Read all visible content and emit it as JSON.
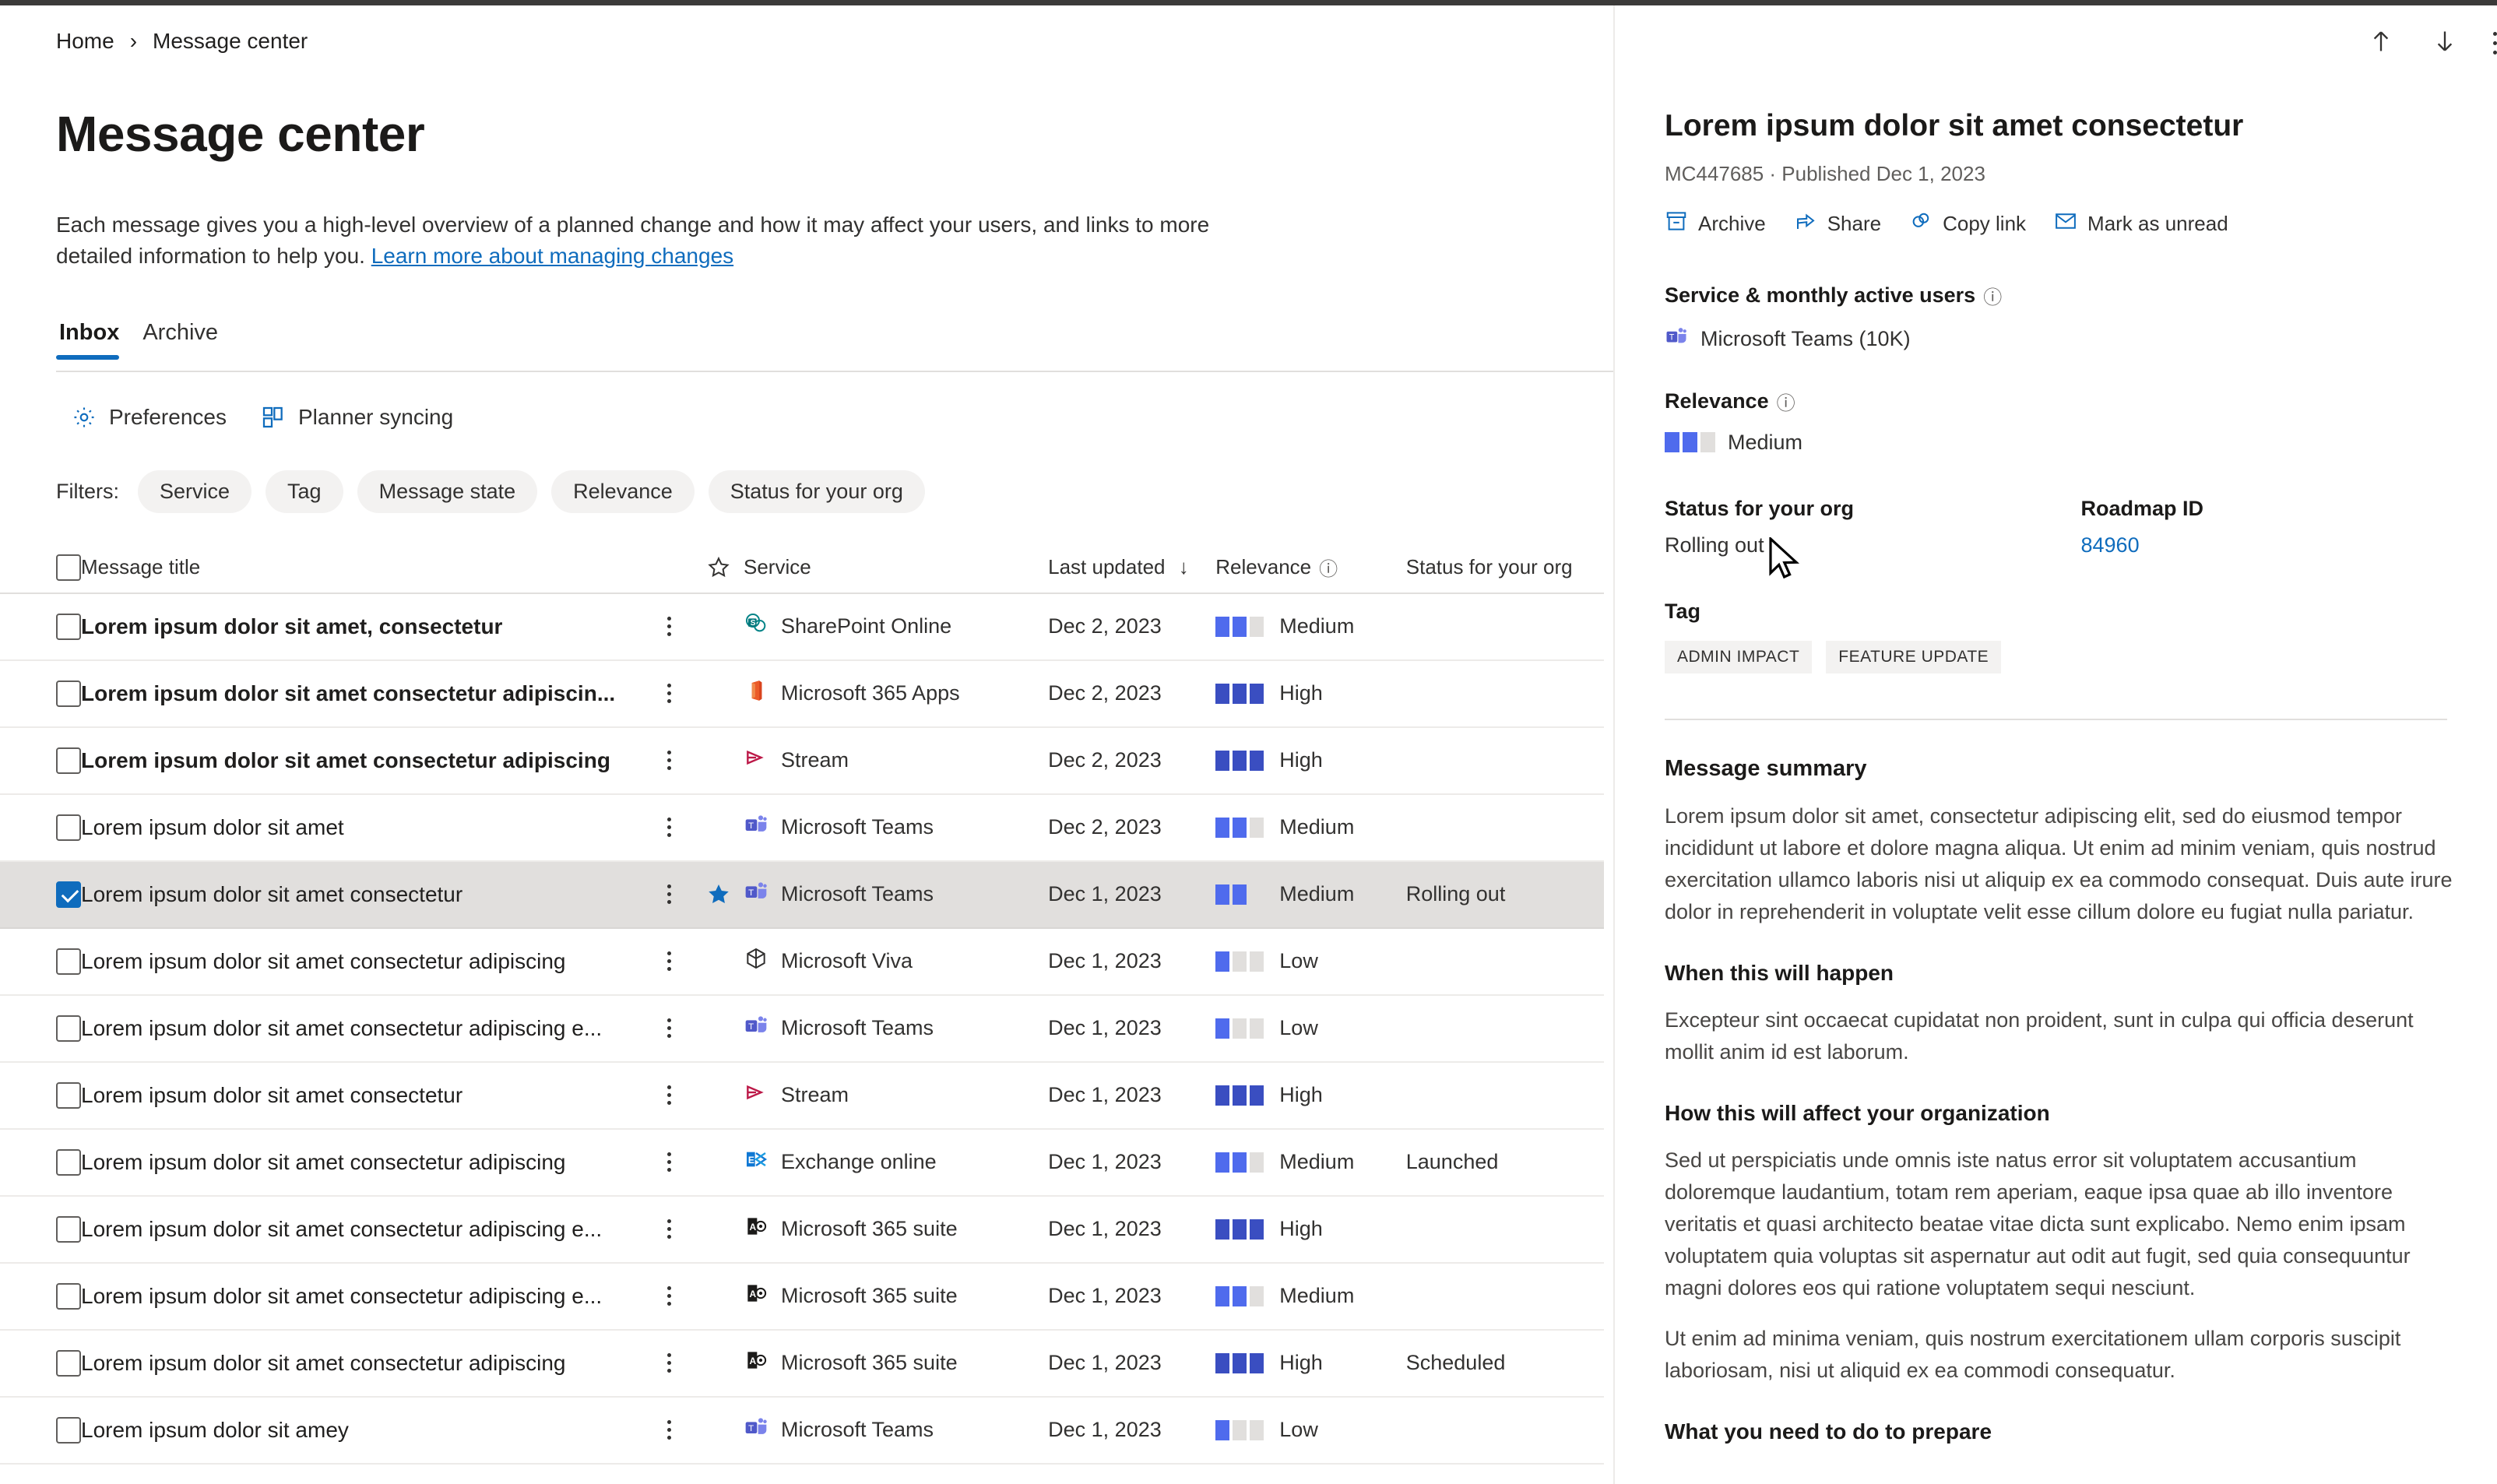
{
  "breadcrumb": {
    "home": "Home",
    "current": "Message center",
    "separator": "›"
  },
  "page": {
    "title": "Message center",
    "intro_before": "Each message gives you a high-level overview of a planned change and how it may affect your users, and links to more detailed information to help you. ",
    "intro_link": "Learn more about managing changes"
  },
  "tabs": [
    {
      "label": "Inbox",
      "active": true
    },
    {
      "label": "Archive",
      "active": false
    }
  ],
  "commands": [
    {
      "label": "Preferences",
      "icon": "gear-icon"
    },
    {
      "label": "Planner syncing",
      "icon": "planner-icon"
    }
  ],
  "filters": {
    "label": "Filters:",
    "items": [
      "Service",
      "Tag",
      "Message state",
      "Relevance",
      "Status for your org"
    ]
  },
  "table": {
    "columns": {
      "message_title": "Message title",
      "star": "star-icon",
      "service": "Service",
      "last_updated": "Last updated",
      "sort_arrow": "↓",
      "relevance": "Relevance",
      "relevance_info": "ⓘ",
      "status": "Status for your org"
    },
    "rows": [
      {
        "title": "Lorem ipsum dolor sit amet, consectetur",
        "unread": true,
        "selected": false,
        "starred": false,
        "service": "SharePoint Online",
        "service_icon": "sharepoint-icon",
        "date": "Dec 2, 2023",
        "relevance": "Medium",
        "relevance_level": 2,
        "status": ""
      },
      {
        "title": "Lorem ipsum dolor sit amet consectetur adipiscin...",
        "unread": true,
        "selected": false,
        "starred": false,
        "service": "Microsoft 365 Apps",
        "service_icon": "m365apps-icon",
        "date": "Dec 2, 2023",
        "relevance": "High",
        "relevance_level": 3,
        "status": ""
      },
      {
        "title": "Lorem ipsum dolor sit amet consectetur adipiscing",
        "unread": true,
        "selected": false,
        "starred": false,
        "service": "Stream",
        "service_icon": "stream-icon",
        "date": "Dec 2, 2023",
        "relevance": "High",
        "relevance_level": 3,
        "status": ""
      },
      {
        "title": "Lorem ipsum dolor sit amet",
        "unread": false,
        "selected": false,
        "starred": false,
        "service": "Microsoft Teams",
        "service_icon": "teams-icon",
        "date": "Dec 2, 2023",
        "relevance": "Medium",
        "relevance_level": 2,
        "status": ""
      },
      {
        "title": "Lorem ipsum dolor sit amet consectetur",
        "unread": false,
        "selected": true,
        "starred": true,
        "service": "Microsoft Teams",
        "service_icon": "teams-icon",
        "date": "Dec 1, 2023",
        "relevance": "Medium",
        "relevance_level": 2,
        "status": "Rolling out"
      },
      {
        "title": "Lorem ipsum dolor sit amet consectetur adipiscing",
        "unread": false,
        "selected": false,
        "starred": false,
        "service": "Microsoft Viva",
        "service_icon": "viva-icon",
        "date": "Dec 1, 2023",
        "relevance": "Low",
        "relevance_level": 1,
        "status": ""
      },
      {
        "title": "Lorem ipsum dolor sit amet consectetur adipiscing e...",
        "unread": false,
        "selected": false,
        "starred": false,
        "service": "Microsoft Teams",
        "service_icon": "teams-icon",
        "date": "Dec 1, 2023",
        "relevance": "Low",
        "relevance_level": 1,
        "status": ""
      },
      {
        "title": "Lorem ipsum dolor sit amet consectetur",
        "unread": false,
        "selected": false,
        "starred": false,
        "service": "Stream",
        "service_icon": "stream-icon",
        "date": "Dec 1, 2023",
        "relevance": "High",
        "relevance_level": 3,
        "status": ""
      },
      {
        "title": "Lorem ipsum dolor sit amet consectetur adipiscing",
        "unread": false,
        "selected": false,
        "starred": false,
        "service": "Exchange online",
        "service_icon": "exchange-icon",
        "date": "Dec 1, 2023",
        "relevance": "Medium",
        "relevance_level": 2,
        "status": "Launched"
      },
      {
        "title": "Lorem ipsum dolor sit amet consectetur adipiscing e...",
        "unread": false,
        "selected": false,
        "starred": false,
        "service": "Microsoft 365 suite",
        "service_icon": "m365suite-icon",
        "date": "Dec 1, 2023",
        "relevance": "High",
        "relevance_level": 3,
        "status": ""
      },
      {
        "title": "Lorem ipsum dolor sit amet consectetur adipiscing e...",
        "unread": false,
        "selected": false,
        "starred": false,
        "service": "Microsoft 365 suite",
        "service_icon": "m365suite-icon",
        "date": "Dec 1, 2023",
        "relevance": "Medium",
        "relevance_level": 2,
        "status": ""
      },
      {
        "title": "Lorem ipsum dolor sit amet consectetur adipiscing",
        "unread": false,
        "selected": false,
        "starred": false,
        "service": "Microsoft 365 suite",
        "service_icon": "m365suite-icon",
        "date": "Dec 1, 2023",
        "relevance": "High",
        "relevance_level": 3,
        "status": "Scheduled"
      },
      {
        "title": "Lorem ipsum dolor sit amey",
        "unread": false,
        "selected": false,
        "starred": false,
        "service": "Microsoft Teams",
        "service_icon": "teams-icon",
        "date": "Dec 1, 2023",
        "relevance": "Low",
        "relevance_level": 1,
        "status": ""
      }
    ]
  },
  "detail": {
    "nav": {
      "previous": "up-arrow-icon",
      "next": "down-arrow-icon",
      "more": "more-actions-icon"
    },
    "title": "Lorem ipsum dolor sit amet consectetur",
    "subtitle": "MC447685 · Published Dec 1, 2023",
    "actions": [
      {
        "label": "Archive",
        "icon": "archive-icon"
      },
      {
        "label": "Share",
        "icon": "share-icon"
      },
      {
        "label": "Copy link",
        "icon": "link-icon"
      },
      {
        "label": "Mark as unread",
        "icon": "mail-icon"
      }
    ],
    "service_section": {
      "label": "Service & monthly active users",
      "info": "ⓘ",
      "value": "Microsoft Teams (10K)",
      "icon": "teams-icon"
    },
    "relevance_section": {
      "label": "Relevance",
      "info": "ⓘ",
      "value": "Medium",
      "level": 2
    },
    "status_section": {
      "label": "Status for your org",
      "value": "Rolling out"
    },
    "roadmap_section": {
      "label": "Roadmap ID",
      "value": "84960"
    },
    "tag_section": {
      "label": "Tag",
      "tags": [
        "ADMIN IMPACT",
        "FEATURE UPDATE"
      ]
    },
    "summary_heading": "Message summary",
    "summary_paragraph": "Lorem ipsum dolor sit amet, consectetur adipiscing elit, sed do eiusmod tempor incididunt ut labore et dolore magna aliqua. Ut enim ad minim veniam, quis nostrud exercitation ullamco laboris nisi ut aliquip ex ea commodo consequat. Duis aute irure dolor in reprehenderit in voluptate velit esse cillum dolore eu fugiat nulla pariatur.",
    "when_heading": "When this will happen",
    "when_paragraph": "Excepteur sint occaecat cupidatat non proident, sunt in culpa qui officia deserunt mollit anim id est laborum.",
    "affect_heading": "How this will affect your organization",
    "affect_paragraph_1": "Sed ut perspiciatis unde omnis iste natus error sit voluptatem accusantium doloremque laudantium, totam rem aperiam, eaque ipsa quae ab illo inventore veritatis et quasi architecto beatae vitae dicta sunt explicabo. Nemo enim ipsam voluptatem quia voluptas sit aspernatur aut odit aut fugit, sed quia consequuntur magni dolores eos qui ratione voluptatem sequi nesciunt.",
    "affect_paragraph_2": "Ut enim ad minima veniam, quis nostrum exercitationem ullam corporis suscipit laboriosam, nisi ut aliquid ex ea commodi consequatur.",
    "prepare_heading": "What you need to do to prepare"
  },
  "colors": {
    "accent": "#0f6cbd",
    "relevance": "#4f6bed",
    "relevance_high": "#3a4ec1",
    "selected_row": "#e1dfdd"
  }
}
